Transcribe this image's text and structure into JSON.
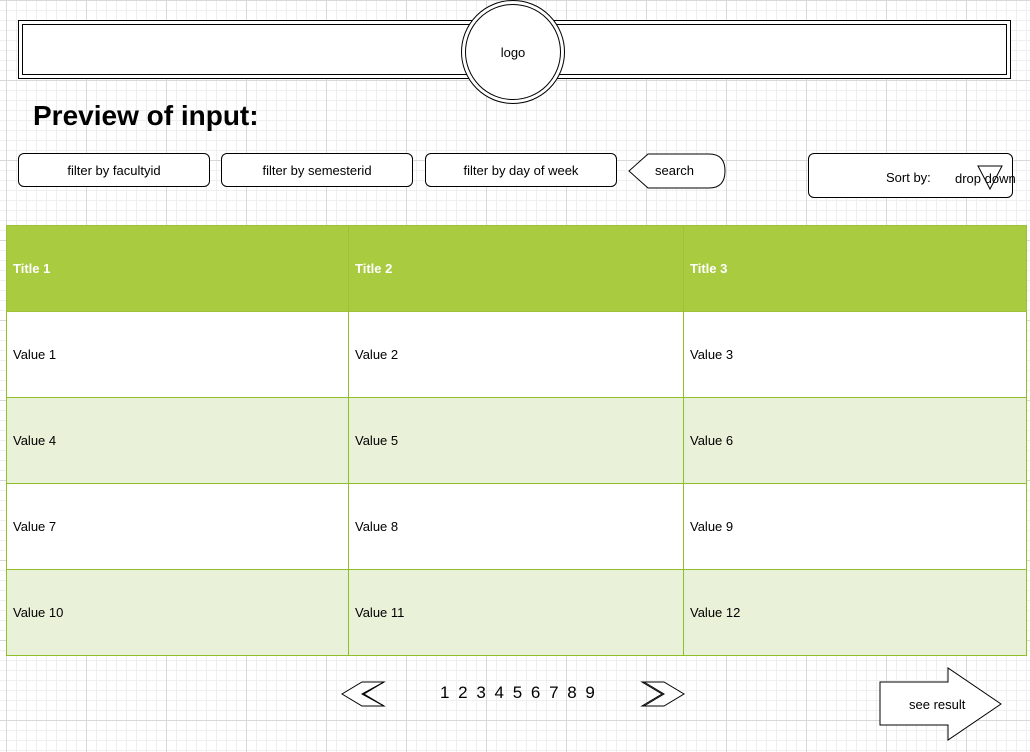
{
  "header": {
    "logo_label": "logo",
    "page_title": "Preview of input:"
  },
  "filters": [
    {
      "label": "filter by facultyid"
    },
    {
      "label": "filter by semesterid"
    },
    {
      "label": "filter by day of week"
    }
  ],
  "search": {
    "label": "search"
  },
  "sort": {
    "label": "Sort by:",
    "value": "drop down"
  },
  "table": {
    "headers": [
      "Title 1",
      "Title 2",
      "Title 3"
    ],
    "rows": [
      [
        "Value 1",
        "Value 2",
        "Value 3"
      ],
      [
        "Value 4",
        "Value 5",
        "Value 6"
      ],
      [
        "Value 7",
        "Value 8",
        "Value 9"
      ],
      [
        "Value 10",
        "Value 11",
        "Value 12"
      ]
    ],
    "header_color": "#a8cb3f",
    "alt_row_color": "#e9f1d8",
    "border_color": "#8fbf2a"
  },
  "pagination": {
    "pages": "1 2 3 4 5 6 7 8 9",
    "prev_icon": "double-chevron-left-icon",
    "next_icon": "double-chevron-right-icon"
  },
  "action": {
    "see_result_label": "see result"
  }
}
